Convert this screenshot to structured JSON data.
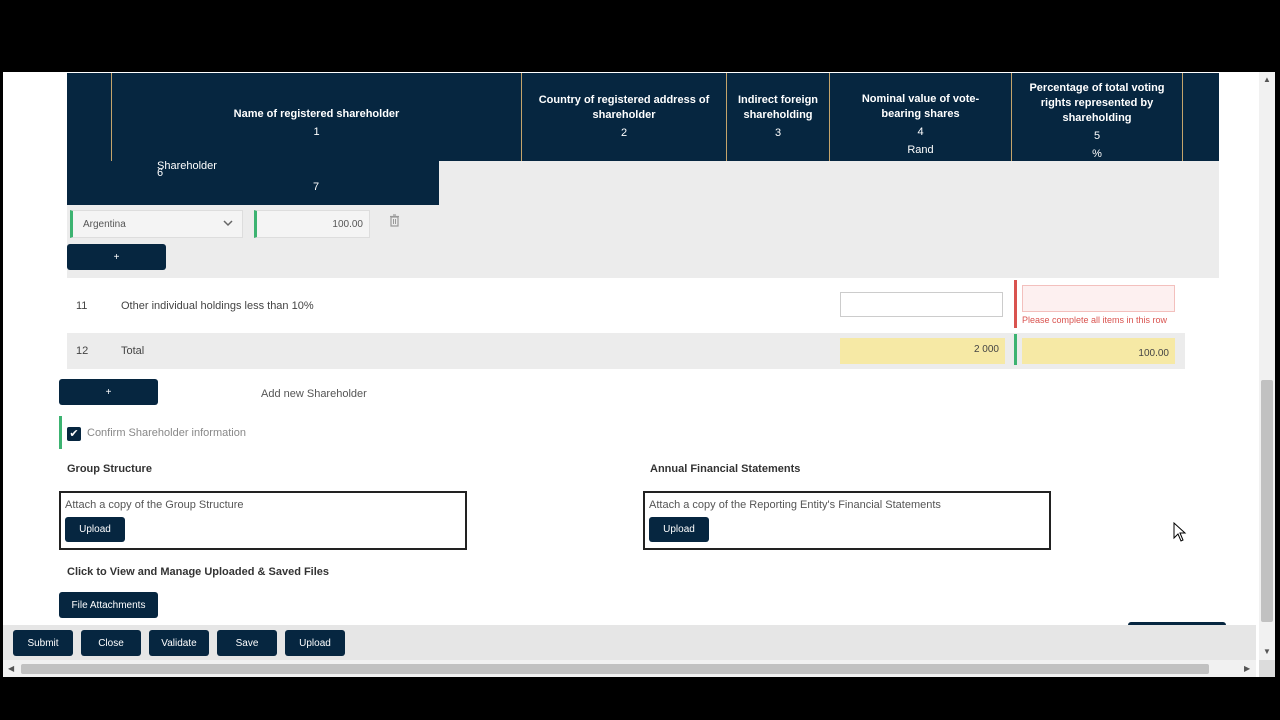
{
  "table": {
    "headers": [
      {
        "title": "Name of registered shareholder",
        "num": "1",
        "unit": ""
      },
      {
        "title": "Country of registered address of shareholder",
        "num": "2",
        "unit": ""
      },
      {
        "title": "Indirect foreign shareholding",
        "num": "3",
        "unit": ""
      },
      {
        "title": "Nominal value of vote-bearing shares",
        "num": "4",
        "unit": "Rand"
      },
      {
        "title": "Percentage of total voting rights represented by shareholding",
        "num": "5",
        "unit": "%"
      }
    ],
    "sub_header": {
      "col_num": "6",
      "partial_label": "Shareholder",
      "num": "7"
    },
    "country_value": "Argentina",
    "percent_value": "100.00",
    "add_country_label": "+",
    "rows": [
      {
        "num": "11",
        "label": "Other individual holdings less than 10%",
        "error": "Please complete all items in this row"
      },
      {
        "num": "12",
        "label": "Total",
        "nominal": "2 000",
        "percent": "100.00"
      }
    ]
  },
  "add_shareholder": {
    "button": "+",
    "label": "Add new Shareholder"
  },
  "confirm": {
    "label": "Confirm Shareholder information",
    "checked": true
  },
  "group_structure": {
    "title": "Group Structure",
    "hint": "Attach a copy of the Group Structure",
    "button": "Upload"
  },
  "financials": {
    "title": "Annual Financial Statements",
    "hint": "Attach a copy of the Reporting Entity's Financial Statements",
    "button": "Upload"
  },
  "files": {
    "title": "Click to View and Manage Uploaded & Saved Files",
    "button": "File Attachments"
  },
  "toolbar": {
    "submit": "Submit",
    "close": "Close",
    "validate": "Validate",
    "save": "Save",
    "upload": "Upload"
  },
  "icons": {
    "trash": "trash-icon",
    "chevron": "chevron-down-icon",
    "check": "check-icon",
    "cursor": "mouse-cursor-icon"
  },
  "colors": {
    "navy": "#062640",
    "gold": "#c4a46b",
    "valid": "#3cb371",
    "error": "#d9534f",
    "total_fill": "#f6e9a5"
  }
}
